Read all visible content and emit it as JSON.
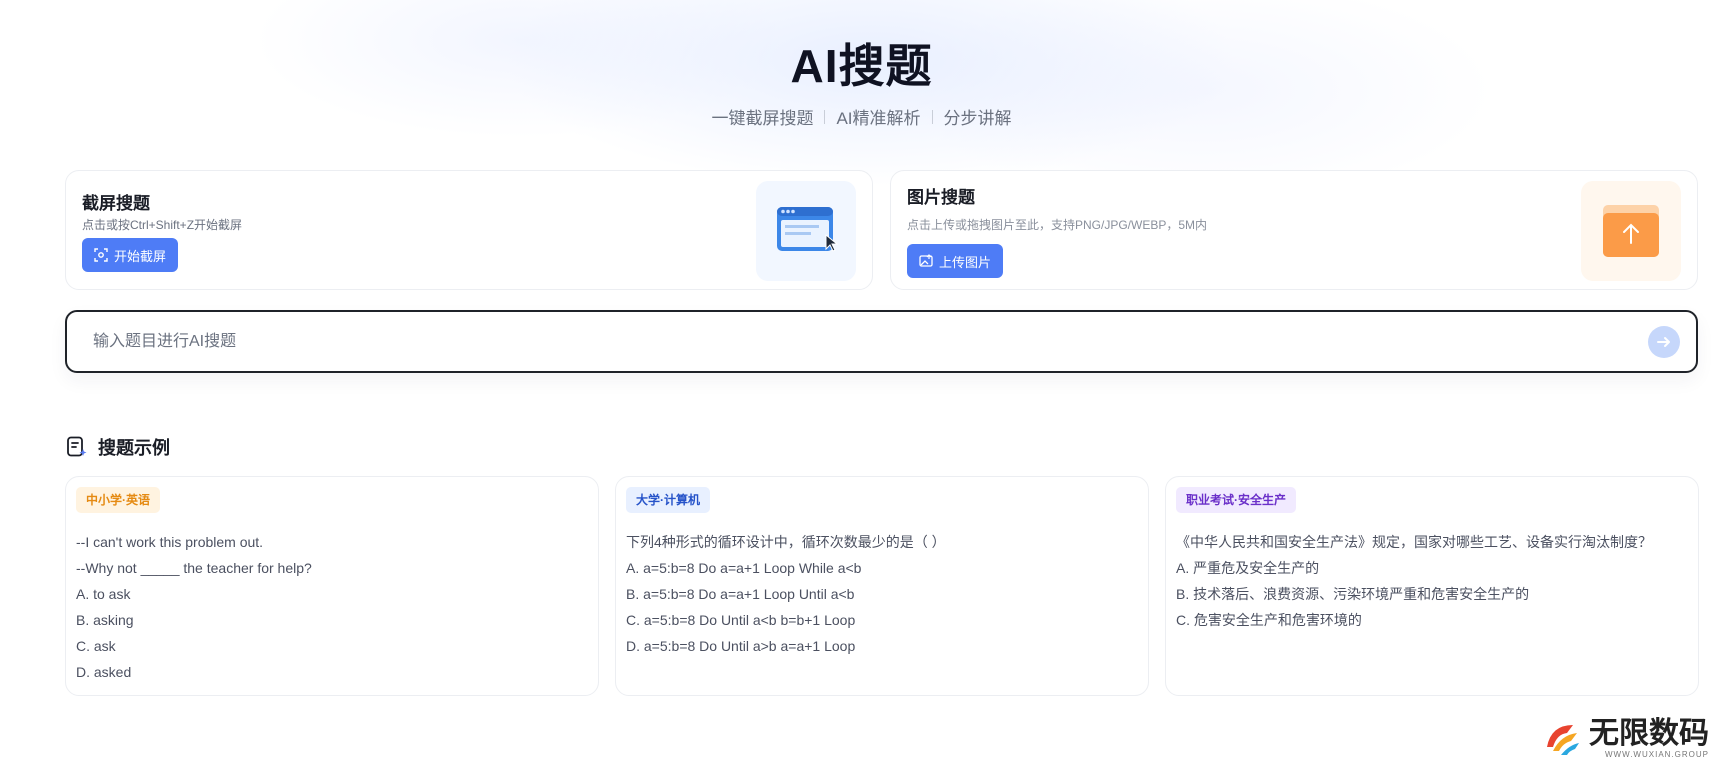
{
  "hero": {
    "title": "AI搜题",
    "subtitle_items": [
      "一键截屏搜题",
      "AI精准解析",
      "分步讲解"
    ]
  },
  "cards": {
    "screenshot": {
      "title": "截屏搜题",
      "desc": "点击或按Ctrl+Shift+Z开始截屏",
      "button_label": "开始截屏",
      "icon": "screenshot-window-icon"
    },
    "image": {
      "title": "图片搜题",
      "desc": "点击上传或拖拽图片至此，支持PNG/JPG/WEBP，5M内",
      "button_label": "上传图片",
      "icon": "folder-upload-icon"
    }
  },
  "search": {
    "placeholder": "输入题目进行AI搜题",
    "value": ""
  },
  "examples": {
    "title": "搜题示例",
    "items": [
      {
        "tag": "中小学·英语",
        "lines": [
          "--I can't work this problem out.",
          "--Why not _____ the teacher for help?",
          "A. to ask",
          "B. asking",
          "C. ask",
          "D. asked"
        ]
      },
      {
        "tag": "大学·计算机",
        "lines": [
          "下列4种形式的循环设计中，循环次数最少的是（ ）",
          "A. a=5:b=8 Do a=a+1 Loop While a<b",
          "B. a=5:b=8 Do a=a+1 Loop Until a<b",
          "C. a=5:b=8 Do Until a<b b=b+1 Loop",
          "D. a=5:b=8 Do Until a>b a=a+1 Loop"
        ]
      },
      {
        "tag": "职业考试·安全生产",
        "lines": [
          "《中华人民共和国安全生产法》规定，国家对哪些工艺、设备实行淘汰制度？",
          "A. 严重危及安全生产的",
          "B. 技术落后、浪费资源、污染环境严重和危害安全生产的",
          "C. 危害安全生产和危害环境的"
        ]
      }
    ]
  },
  "brand": {
    "name": "无限数码",
    "sub": "WWW.WUXIAN.GROUP"
  },
  "colors": {
    "primary": "#4e7cf6",
    "tag_orange": "#e58a12",
    "tag_blue": "#2653c9",
    "tag_purple": "#6a2fc9"
  }
}
